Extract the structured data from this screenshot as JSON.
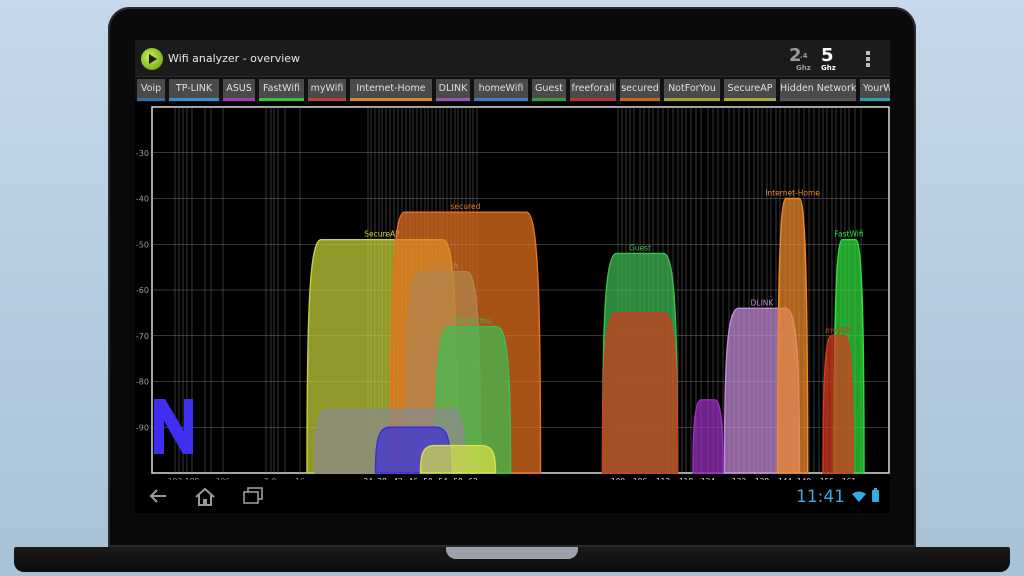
{
  "app": {
    "title": "Wifi analyzer - overview"
  },
  "band_selector": {
    "b24": {
      "main": "2",
      "sub_top": ".4",
      "sub_bottom": "Ghz"
    },
    "b5": {
      "main": "5",
      "sub_bottom": "Ghz"
    },
    "active": "5"
  },
  "tabs": [
    {
      "label": "Voip",
      "color": "#2f6fa8"
    },
    {
      "label": "TP-LINK",
      "color": "#3a8fd0"
    },
    {
      "label": "ASUS",
      "color": "#9c3fb0"
    },
    {
      "label": "FastWifi",
      "color": "#3fbf3f"
    },
    {
      "label": "myWifi",
      "color": "#c23b3b"
    },
    {
      "label": "Internet-Home",
      "color": "#d08a2a"
    },
    {
      "label": "DLINK",
      "color": "#9a57b8"
    },
    {
      "label": "homeWifi",
      "color": "#3c7fc8"
    },
    {
      "label": "Guest",
      "color": "#3c9a3c"
    },
    {
      "label": "freeforall",
      "color": "#c03030"
    },
    {
      "label": "secured",
      "color": "#c4681c"
    },
    {
      "label": "NotForYou",
      "color": "#a0a038"
    },
    {
      "label": "SecureAP",
      "color": "#a8a838"
    },
    {
      "label": "Hidden Network",
      "color": "#555555"
    },
    {
      "label": "YourWifi",
      "color": "#2aa0b0"
    }
  ],
  "chart_data": {
    "type": "area",
    "ylim": [
      -100,
      -20
    ],
    "y_ticks": [
      -30,
      -40,
      -50,
      -60,
      -70,
      -80,
      -90
    ],
    "x_tick_labels": [
      "183",
      "188",
      "196",
      "7",
      "9",
      "16",
      "34",
      "38",
      "42",
      "46",
      "50",
      "54",
      "58",
      "62",
      "100",
      "106",
      "112",
      "118",
      "124",
      "132",
      "138",
      "144",
      "149",
      "155",
      "161"
    ],
    "series": [
      {
        "name": "SecureAP",
        "channel": 38,
        "width": 40,
        "signal": -49,
        "color": "#c8d33a"
      },
      {
        "name": "YourWifi",
        "channel": 54,
        "width": 20,
        "signal": -56,
        "color": "#2ab5c9"
      },
      {
        "name": "secured",
        "channel": 60,
        "width": 40,
        "signal": -43,
        "color": "#e8711f"
      },
      {
        "name": "NotForYou",
        "channel": 62,
        "width": 20,
        "signal": -68,
        "color": "#3ebd52"
      },
      {
        "name": "",
        "channel": 40,
        "width": 40,
        "signal": -86,
        "color": "#8a8a8a"
      },
      {
        "name": "",
        "channel": 46,
        "width": 20,
        "signal": -90,
        "color": "#3a2fd8"
      },
      {
        "name": "",
        "channel": 58,
        "width": 20,
        "signal": -94,
        "color": "#d8e04a"
      },
      {
        "name": "Guest",
        "channel": 106,
        "width": 20,
        "signal": -52,
        "color": "#3ebd52"
      },
      {
        "name": "",
        "channel": 106,
        "width": 20,
        "signal": -65,
        "color": "#d23a1e"
      },
      {
        "name": "",
        "channel": 124,
        "width": 8,
        "signal": -84,
        "color": "#9a2fc0"
      },
      {
        "name": "DLINK",
        "channel": 138,
        "width": 20,
        "signal": -64,
        "color": "#c58ad8"
      },
      {
        "name": "Internet-Home",
        "channel": 146,
        "width": 8,
        "signal": -40,
        "color": "#f08a2a"
      },
      {
        "name": "FastWifi",
        "channel": 161,
        "width": 8,
        "signal": -49,
        "color": "#2fe03a"
      },
      {
        "name": "myWifi",
        "channel": 158,
        "width": 8,
        "signal": -70,
        "color": "#d83a1e"
      }
    ],
    "grid": true
  },
  "navbar": {
    "clock": "11:41"
  }
}
